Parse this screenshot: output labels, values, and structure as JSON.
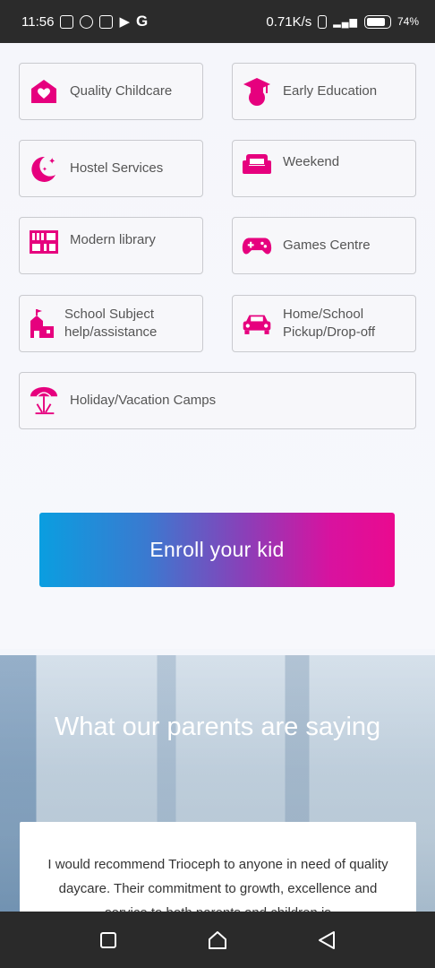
{
  "status_bar": {
    "time": "11:56",
    "net_speed": "0.71K/s",
    "battery": "74%"
  },
  "services": [
    {
      "label": "Quality Childcare",
      "icon": "heart-house-icon"
    },
    {
      "label": "Early Education",
      "icon": "graduate-icon"
    },
    {
      "label": "Hostel Services",
      "icon": "moon-stars-icon"
    },
    {
      "label": "Weekend",
      "icon": "sofa-icon"
    },
    {
      "label": "Modern library",
      "icon": "bookshelf-icon"
    },
    {
      "label": "Games Centre",
      "icon": "gamepad-icon"
    },
    {
      "label": "School Subject help/assistance",
      "icon": "school-icon"
    },
    {
      "label": "Home/School Pickup/Drop-off",
      "icon": "car-icon"
    },
    {
      "label": "Holiday/Vacation Camps",
      "icon": "beach-umbrella-icon"
    }
  ],
  "enroll_button": "Enroll your kid",
  "testimonials": {
    "heading": "What our parents are saying",
    "quote": "I would recommend Trioceph to anyone in need of quality daycare. Their commitment to growth, excellence and service to both parents and children is"
  },
  "colors": {
    "accent_pink": "#e6007e",
    "gradient_start": "#0a9ee0",
    "gradient_end": "#ea0a8f"
  }
}
